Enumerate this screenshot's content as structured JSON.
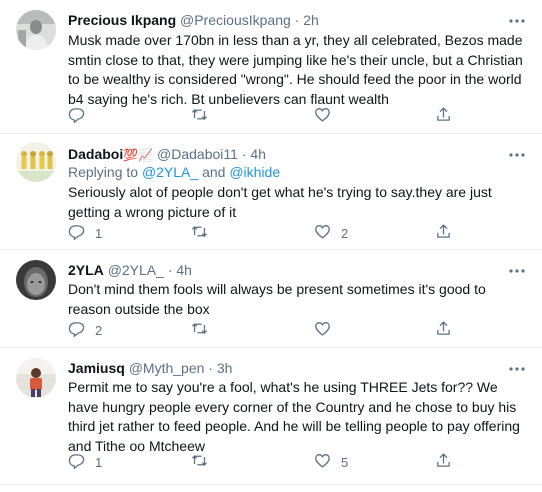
{
  "tweets": [
    {
      "name": "Precious Ikpang",
      "name_emoji": "",
      "handle": "@PreciousIkpang",
      "time": "2h",
      "replying_prefix": "",
      "replying_to": [],
      "text": "Musk made over 170bn in less than a yr, they all celebrated, Bezos made smtin close to that, they were jumping like he's their uncle, but a Christian to be wealthy is considered \"wrong\". He should feed the poor in the world b4 saying he's rich. Bt unbelievers can flaunt wealth",
      "reply_count": "",
      "retweet_count": "",
      "like_count": ""
    },
    {
      "name": "Dadaboi",
      "name_emoji": "💯📈",
      "handle": "@Dadaboi11",
      "time": "4h",
      "replying_prefix": "Replying to",
      "replying_to": [
        "@2YLA_",
        "@ikhide"
      ],
      "replying_and": "and",
      "text": "Seriously alot of people don't get what he's trying to say.they are just getting a wrong picture of it",
      "reply_count": "1",
      "retweet_count": "",
      "like_count": "2"
    },
    {
      "name": "2YLA",
      "name_emoji": "",
      "handle": "@2YLA_",
      "time": "4h",
      "replying_prefix": "",
      "replying_to": [],
      "text": "Don't mind them fools will always be present sometimes it's good to reason outside the box",
      "reply_count": "2",
      "retweet_count": "",
      "like_count": ""
    },
    {
      "name": "Jamiusq",
      "name_emoji": "",
      "handle": "@Myth_pen",
      "time": "3h",
      "replying_prefix": "",
      "replying_to": [],
      "text": "Permit me to say you're a fool, what's he using THREE Jets for?? We have hungry people every corner of the Country and he chose to buy his third jet rather to feed people. And he will be telling people to pay offering and Tithe oo Mtcheew",
      "reply_count": "1",
      "retweet_count": "",
      "like_count": "5"
    }
  ],
  "separator_dot": "·",
  "icons": [
    "more-icon",
    "reply-icon",
    "retweet-icon",
    "like-icon",
    "share-icon"
  ],
  "colors": {
    "link": "#1b95e0",
    "secondary": "#5b7083",
    "divider": "#ebeef0"
  }
}
